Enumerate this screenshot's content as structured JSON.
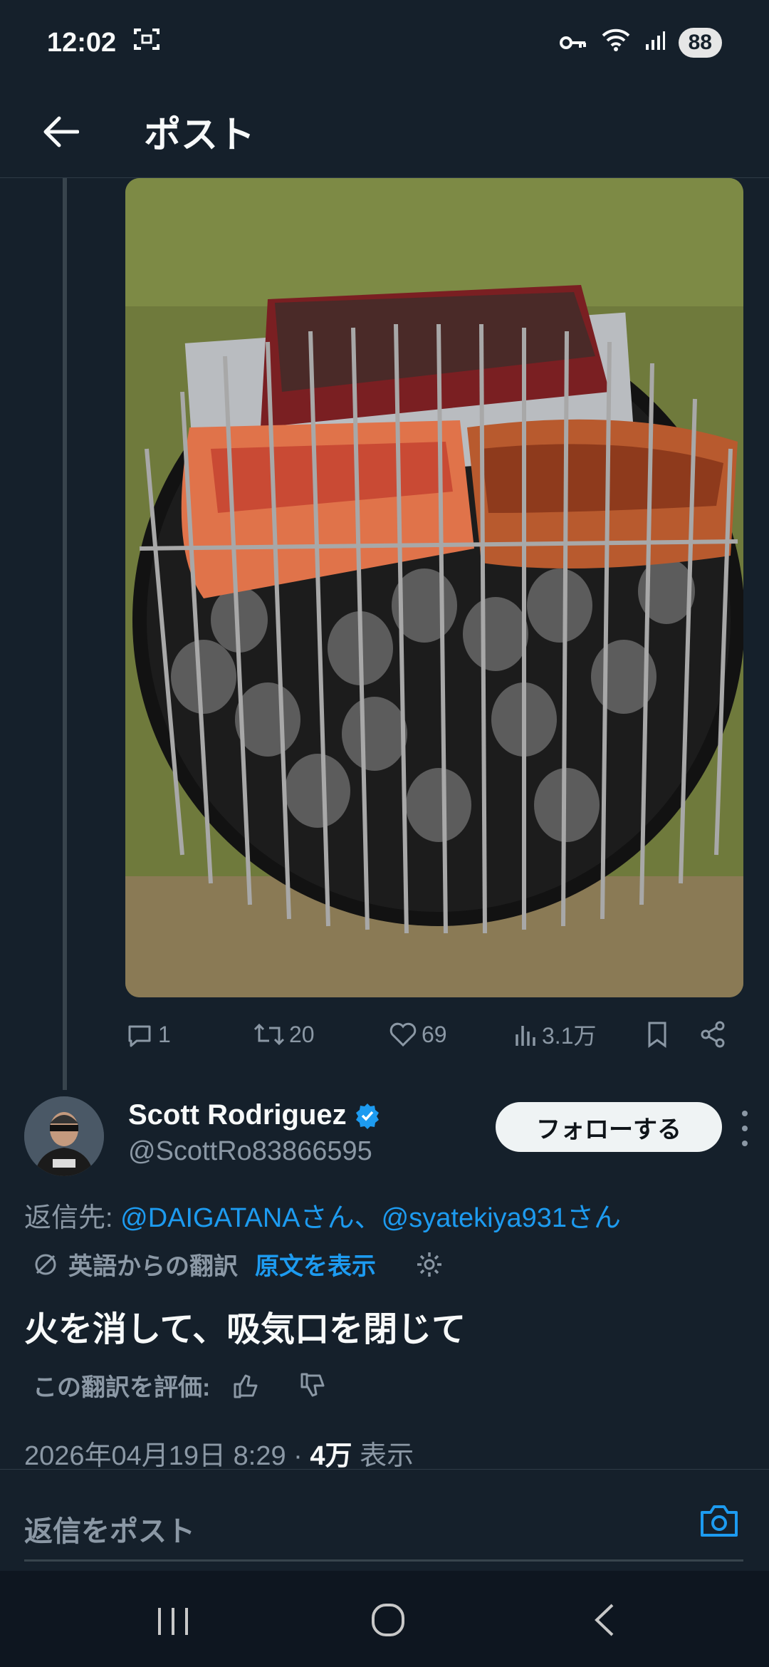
{
  "status_bar": {
    "time": "12:02",
    "battery": "88"
  },
  "header": {
    "title": "ポスト"
  },
  "parent_post": {
    "stats": {
      "replies": "1",
      "reposts": "20",
      "likes": "69",
      "views": "3.1万"
    }
  },
  "post": {
    "author_name": "Scott Rodriguez",
    "author_handle": "@ScottRo83866595",
    "follow_label": "フォローする",
    "reply_to_prefix": "返信先: ",
    "reply_to_user1": "@DAIGATANAさん",
    "reply_to_sep": "、",
    "reply_to_user2": "@syatekiya931さん",
    "translation_label": "英語からの翻訳",
    "show_original_label": "原文を表示",
    "text": "火を消して、吸気口を閉じて",
    "rate_label": "この翻訳を評価:",
    "timestamp": "2026年04月19日 8:29",
    "views_sep": " · ",
    "views_count": "4万",
    "views_label": " 表示"
  },
  "reply_bar": {
    "placeholder": "返信をポスト"
  },
  "colors": {
    "background": "#15202b",
    "accent": "#1d9bf0",
    "muted": "#8b98a5"
  }
}
